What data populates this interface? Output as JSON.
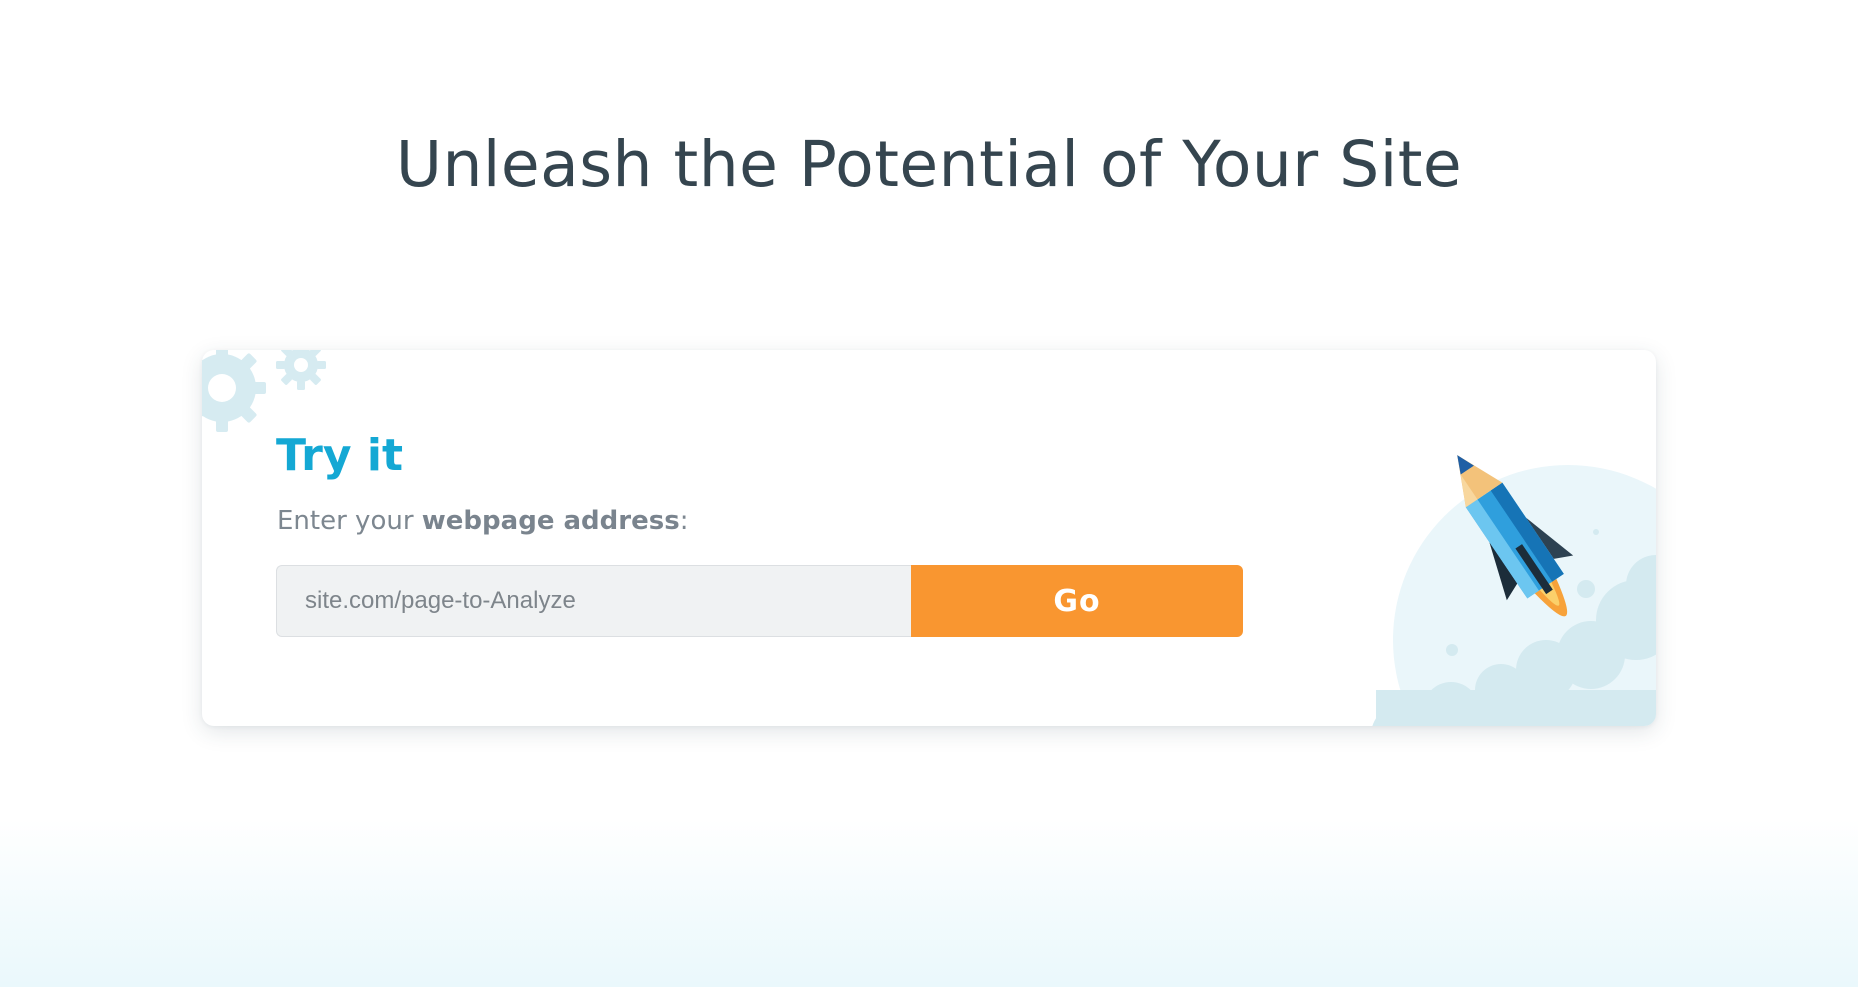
{
  "hero": {
    "title": "Unleash the Potential of Your Site"
  },
  "try_card": {
    "title": "Try it",
    "prompt_prefix": "Enter your ",
    "prompt_bold": "webpage address",
    "prompt_suffix": ":",
    "url_input": {
      "placeholder": "site.com/page-to-Analyze",
      "value": ""
    },
    "go_label": "Go"
  },
  "colors": {
    "accent_blue": "#14a8d4",
    "button_orange": "#f99630",
    "heading_dark": "#35454f",
    "muted_text": "#7d8790"
  },
  "icons": {
    "decor_top_left": "gears-icon",
    "decor_right": "rocket-icon"
  }
}
